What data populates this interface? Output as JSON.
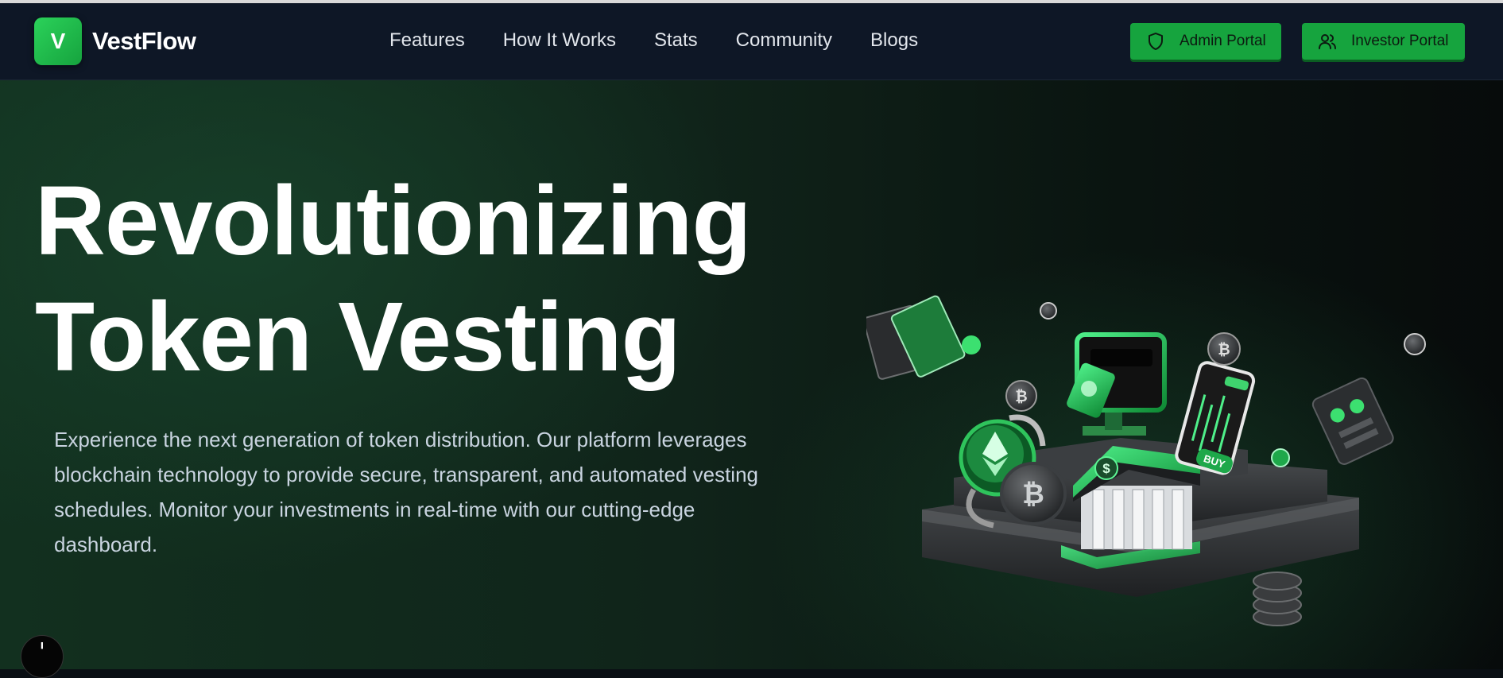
{
  "brand": {
    "logo_letter": "V",
    "name": "VestFlow"
  },
  "nav": {
    "links": [
      "Features",
      "How It Works",
      "Stats",
      "Community",
      "Blogs"
    ]
  },
  "actions": {
    "admin_label": "Admin Portal",
    "investor_label": "Investor Portal"
  },
  "hero": {
    "title_line1": "Revolutionizing",
    "title_line2": "Token Vesting",
    "description": "Experience the next generation of token distribution. Our platform leverages blockchain technology to provide secure, transparent, and automated vesting schedules. Monitor your investments in real-time with our cutting-edge dashboard.",
    "art": {
      "buy_tag": "BUY",
      "bank_symbol": "$"
    }
  },
  "colors": {
    "accent": "#16a43e",
    "nav_bg": "#0e1726",
    "hero_bg": "#10241a"
  },
  "icons": {
    "admin": "shield-icon",
    "investor": "users-icon",
    "help": "help-icon"
  }
}
